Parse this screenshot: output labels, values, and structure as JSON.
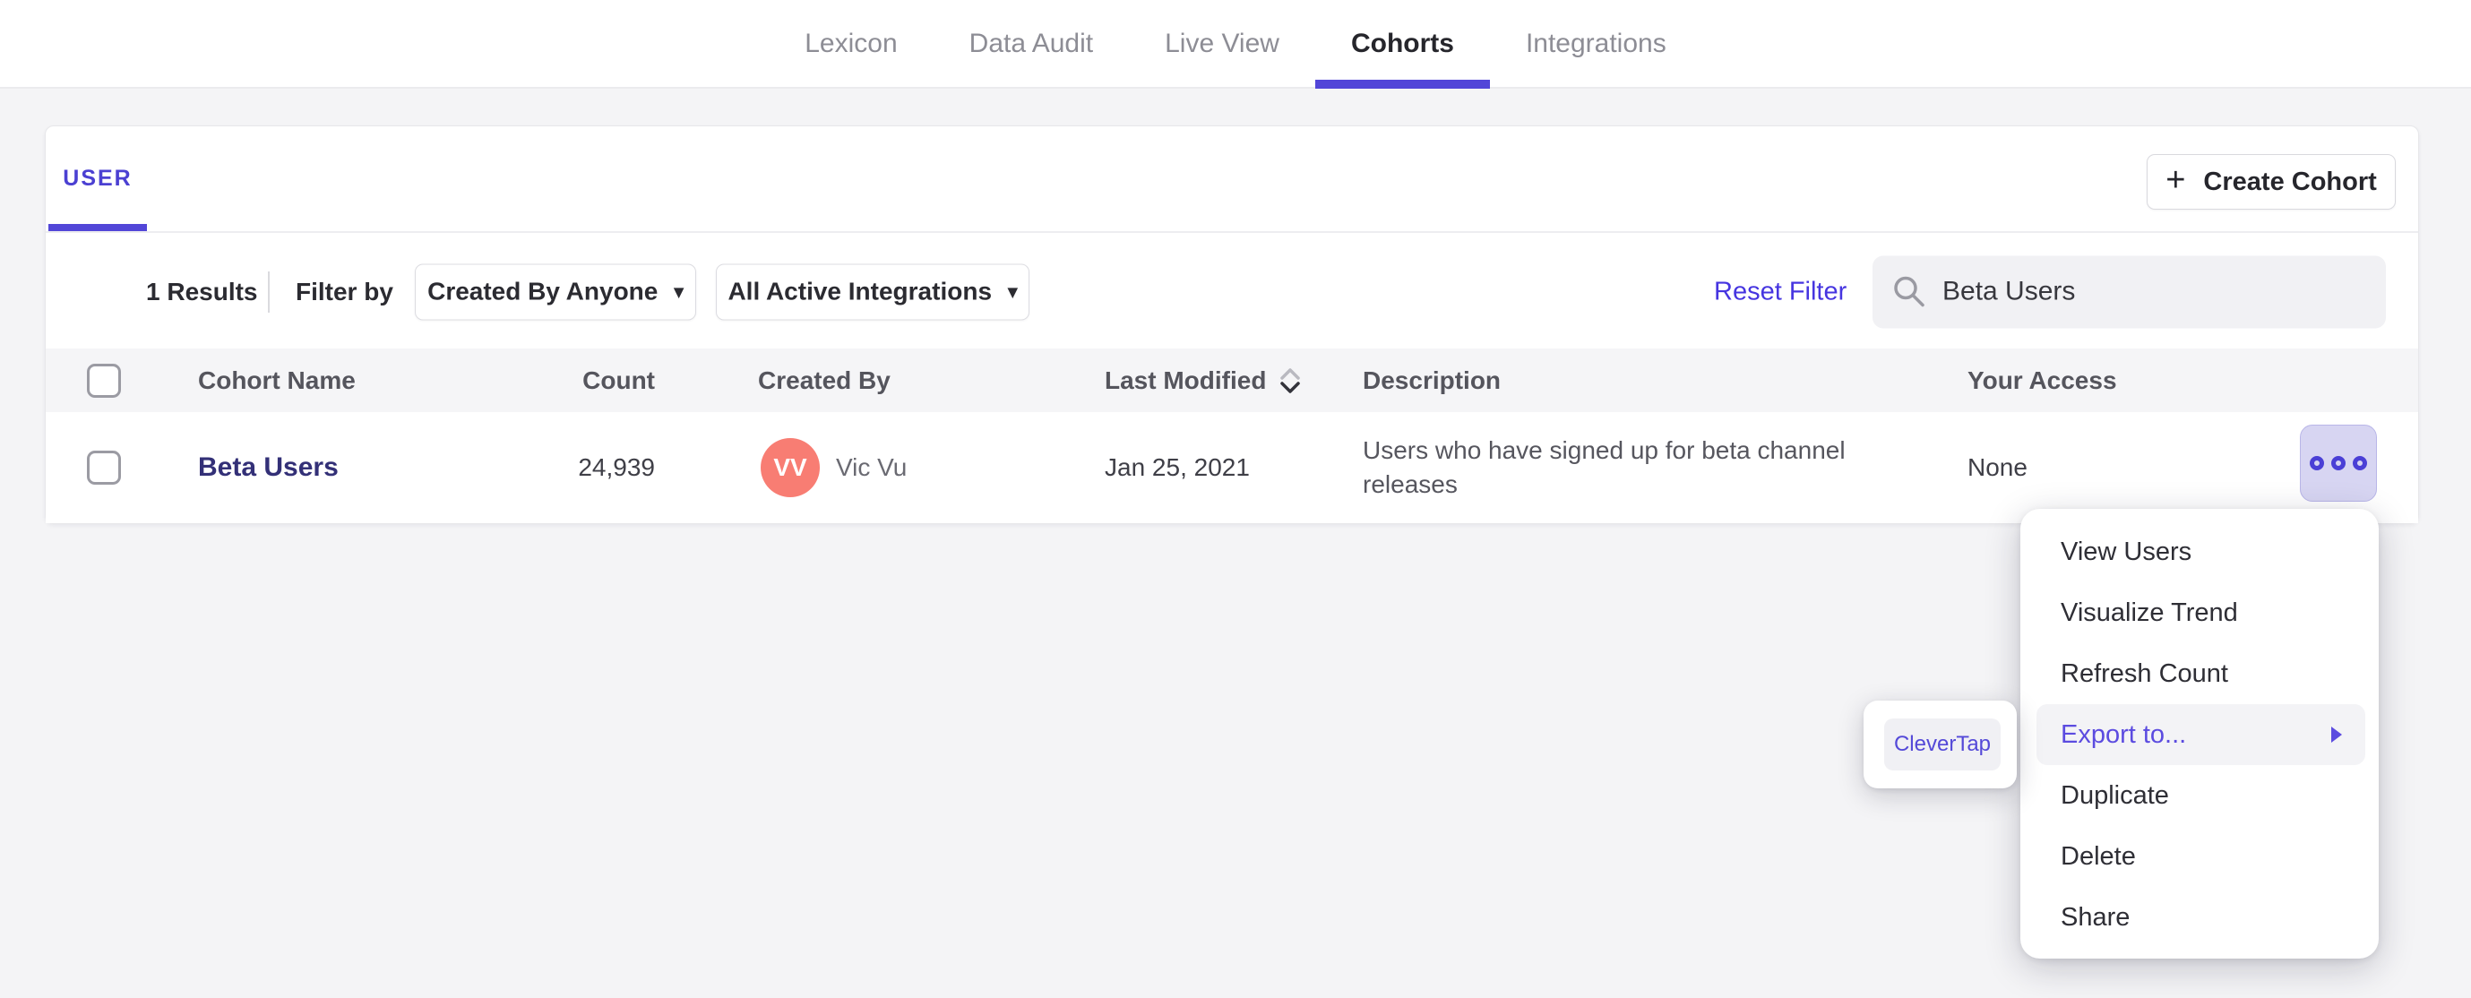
{
  "nav": {
    "tabs": [
      {
        "label": "Lexicon",
        "active": false
      },
      {
        "label": "Data Audit",
        "active": false
      },
      {
        "label": "Live View",
        "active": false
      },
      {
        "label": "Cohorts",
        "active": true
      },
      {
        "label": "Integrations",
        "active": false
      }
    ]
  },
  "cohorts_card": {
    "type_tab": "USER",
    "create_cohort": {
      "icon": "+",
      "label": "Create Cohort"
    },
    "filters": {
      "results": "1 Results",
      "filter_by": "Filter by",
      "created_by": "Created By Anyone",
      "integrations": "All Active Integrations",
      "dropdown_caret": "▾",
      "reset": "Reset Filter",
      "search_value": "Beta Users"
    },
    "table": {
      "headers": {
        "name": "Cohort Name",
        "count": "Count",
        "created_by": "Created By",
        "last_modified": "Last Modified",
        "description": "Description",
        "access": "Your Access"
      },
      "row": {
        "name": "Beta Users",
        "count": "24,939",
        "avatar_initials": "VV",
        "creator": "Vic Vu",
        "last_modified": "Jan 25, 2021",
        "description": "Users who have signed up for beta channel releases",
        "access": "None"
      }
    }
  },
  "context_menu": {
    "items": [
      "View Users",
      "Visualize Trend",
      "Refresh Count",
      "Export to...",
      "Duplicate",
      "Delete",
      "Share"
    ],
    "highlighted_item": "Export to...",
    "submenu": {
      "item": "CleverTap"
    }
  },
  "icons": {
    "search": "magnifier",
    "more_actions": "three-rings",
    "sort": "up-down-chevrons",
    "submenu_arrow": "right-triangle",
    "dropdown_caret": "down-caret"
  },
  "colors": {
    "accent_purple": "#5246d8",
    "link_purple": "#4635e0",
    "cohort_link_navy": "#333077",
    "avatar_coral": "#f87d73",
    "more_button_bg": "#d7d5f2",
    "menu_highlight_bg": "#f3f3f6",
    "page_bg": "#f4f4f6"
  }
}
